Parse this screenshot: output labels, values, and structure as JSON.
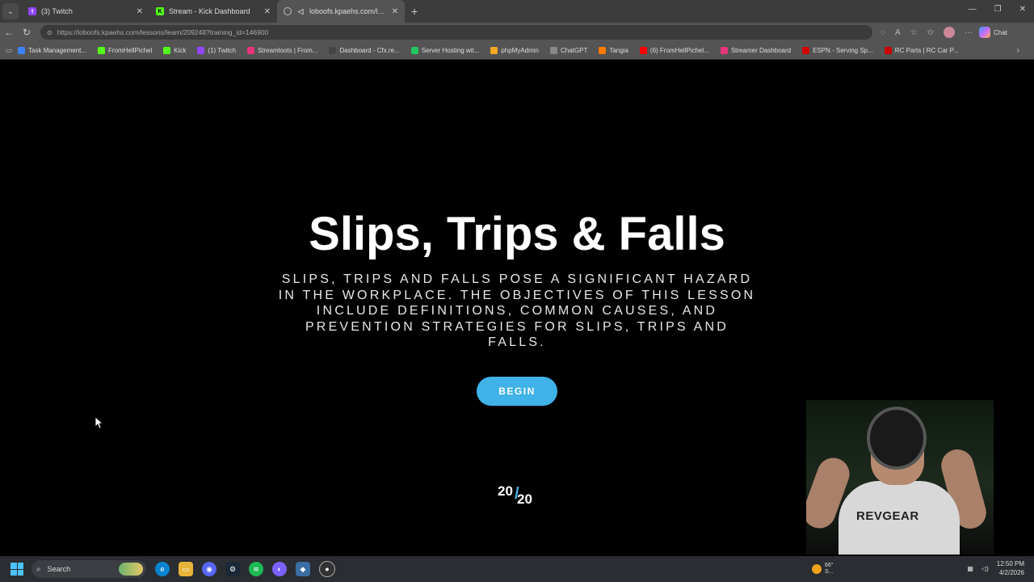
{
  "browser": {
    "tabs": [
      {
        "label": "(3) Twitch",
        "favicon": "twitch-icon",
        "active": false
      },
      {
        "label": "Stream - Kick Dashboard",
        "favicon": "kick-icon",
        "active": false
      },
      {
        "label": "loboofs.kpaehs.com/lessons/l",
        "favicon": "globe-icon",
        "active": true
      }
    ],
    "address": "https://loboofs.kpaehs.com/lessons/learn/209248?training_id=146900",
    "chat_label": "Chat"
  },
  "bookmarks": [
    {
      "label": "Task Management...",
      "color": "#3b82f6"
    },
    {
      "label": "FromHellPichel",
      "color": "#53fc18"
    },
    {
      "label": "Kick",
      "color": "#53fc18"
    },
    {
      "label": "(1) Twitch",
      "color": "#9146ff"
    },
    {
      "label": "Streamloots | From...",
      "color": "#e6357a"
    },
    {
      "label": "Dashboard - Cfx.re...",
      "color": "#444444"
    },
    {
      "label": "Server Hosting wit...",
      "color": "#22c55e"
    },
    {
      "label": "phpMyAdmin",
      "color": "#f5a623"
    },
    {
      "label": "ChatGPT",
      "color": "#888888"
    },
    {
      "label": "Tangia",
      "color": "#ff7a00"
    },
    {
      "label": "(6) FromHellPichel...",
      "color": "#ff0000"
    },
    {
      "label": "Streamer Dashboard",
      "color": "#e6357a"
    },
    {
      "label": "ESPN - Serving Sp...",
      "color": "#d00000"
    },
    {
      "label": "RC Parts | RC Car P...",
      "color": "#cc0000"
    }
  ],
  "lesson": {
    "title": "Slips, Trips & Falls",
    "description": "SLIPS, TRIPS AND FALLS POSE A SIGNIFICANT HAZARD IN THE WORKPLACE. THE OBJECTIVES OF THIS LESSON INCLUDE DEFINITIONS, COMMON CAUSES, AND PREVENTION STRATEGIES FOR SLIPS, TRIPS AND FALLS.",
    "begin_label": "BEGIN",
    "logo_top": "20",
    "logo_bottom": "20",
    "accent": "#3fb2e8"
  },
  "webcam": {
    "shirt_text": "REVGEAR"
  },
  "taskbar": {
    "search_placeholder": "Search",
    "weather_temp": "66°",
    "weather_cond": "S...",
    "time": "12:50 PM",
    "date": "4/2/2026"
  }
}
